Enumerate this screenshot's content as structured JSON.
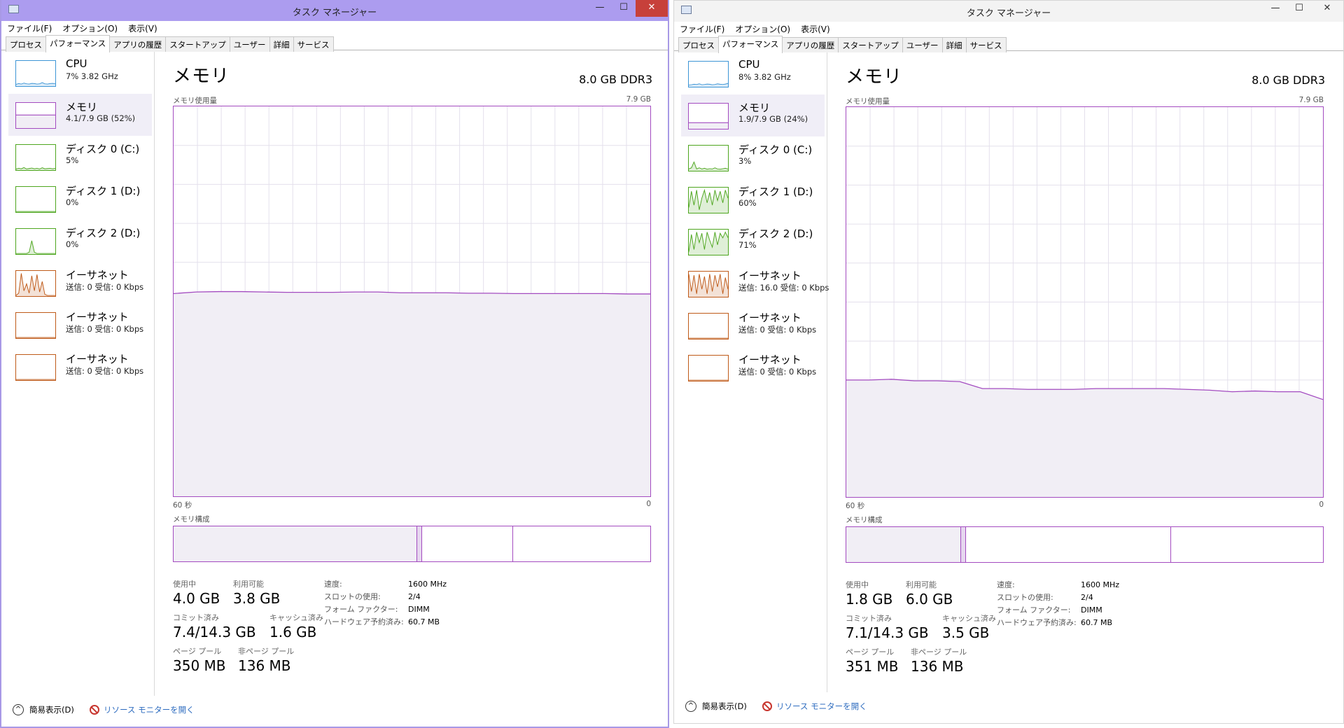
{
  "colors": {
    "memory": "#a34bc0",
    "memory_fill": "#f1eef5",
    "cpu": "#3d95d6",
    "disk": "#4ea61f",
    "net": "#bf5a19",
    "grid": "#e4e0ec"
  },
  "windows": [
    {
      "title": "タスク マネージャー",
      "controls": {
        "minimize": "—",
        "maximize": "☐",
        "close": "✕"
      },
      "menu": [
        "ファイル(F)",
        "オプション(O)",
        "表示(V)"
      ],
      "tabs": [
        "プロセス",
        "パフォーマンス",
        "アプリの履歴",
        "スタートアップ",
        "ユーザー",
        "詳細",
        "サービス"
      ],
      "active_tab": 1,
      "sidebar": [
        {
          "name": "CPU",
          "sub": "7% 3.82 GHz",
          "kind": "cpu",
          "spark": [
            0.05,
            0.08,
            0.06,
            0.1,
            0.07,
            0.06,
            0.09,
            0.08,
            0.06,
            0.07,
            0.12,
            0.07,
            0.06,
            0.08,
            0.09,
            0.07
          ]
        },
        {
          "name": "メモリ",
          "sub": "4.1/7.9 GB (52%)",
          "kind": "mem",
          "level": 0.52
        },
        {
          "name": "ディスク 0 (C:)",
          "sub": "5%",
          "kind": "disk",
          "spark": [
            0.02,
            0.05,
            0.03,
            0.08,
            0.02,
            0.04,
            0.06,
            0.03,
            0.05,
            0.02,
            0.07,
            0.03,
            0.04,
            0.05,
            0.03,
            0.05
          ]
        },
        {
          "name": "ディスク 1 (D:)",
          "sub": "0%",
          "kind": "disk",
          "spark": [
            0,
            0,
            0,
            0,
            0,
            0,
            0,
            0,
            0,
            0,
            0,
            0,
            0,
            0,
            0,
            0
          ]
        },
        {
          "name": "ディスク 2 (D:)",
          "sub": "0%",
          "kind": "disk",
          "spark": [
            0,
            0,
            0,
            0,
            0,
            0.05,
            0.55,
            0.05,
            0,
            0,
            0,
            0,
            0,
            0,
            0,
            0
          ]
        },
        {
          "name": "イーサネット",
          "sub": "送信: 0 受信: 0 Kbps",
          "kind": "net",
          "spark": [
            0,
            0.1,
            0.95,
            0.2,
            0.5,
            0.1,
            0.85,
            0.2,
            0.9,
            0.15,
            0.6,
            0.05,
            0,
            0,
            0,
            0
          ]
        },
        {
          "name": "イーサネット",
          "sub": "送信: 0 受信: 0 Kbps",
          "kind": "net",
          "spark": [
            0,
            0,
            0,
            0,
            0,
            0,
            0,
            0,
            0,
            0,
            0,
            0,
            0,
            0,
            0,
            0
          ]
        },
        {
          "name": "イーサネット",
          "sub": "送信: 0 受信: 0 Kbps",
          "kind": "net",
          "spark": [
            0,
            0,
            0,
            0,
            0,
            0,
            0,
            0,
            0,
            0,
            0,
            0,
            0,
            0,
            0,
            0
          ]
        }
      ],
      "selected": 1,
      "main": {
        "title": "メモリ",
        "spec": "8.0 GB DDR3",
        "usage_label": "メモリ使用量",
        "max_label": "7.9 GB",
        "time_left": "60 秒",
        "time_right": "0",
        "usage_series": [
          0.52,
          0.524,
          0.525,
          0.525,
          0.524,
          0.523,
          0.523,
          0.523,
          0.524,
          0.524,
          0.522,
          0.522,
          0.522,
          0.521,
          0.521,
          0.52,
          0.52,
          0.52,
          0.52,
          0.52,
          0.519,
          0.519
        ],
        "composition_label": "メモリ構成",
        "composition": {
          "in_use": 0.51,
          "modified": 0.01,
          "standby": 0.19,
          "free": 0.29
        },
        "stats": [
          {
            "label": "使用中",
            "value": "4.0 GB"
          },
          {
            "label": "利用可能",
            "value": "3.8 GB"
          },
          {
            "label": "コミット済み",
            "value": "7.4/14.3 GB"
          },
          {
            "label": "キャッシュ済み",
            "value": "1.6 GB"
          },
          {
            "label": "ページ プール",
            "value": "350 MB"
          },
          {
            "label": "非ページ プール",
            "value": "136 MB"
          }
        ],
        "details": [
          {
            "k": "速度:",
            "v": "1600 MHz"
          },
          {
            "k": "スロットの使用:",
            "v": "2/4"
          },
          {
            "k": "フォーム ファクター:",
            "v": "DIMM"
          },
          {
            "k": "ハードウェア予約済み:",
            "v": "60.7 MB"
          }
        ]
      },
      "footer": {
        "fewer": "簡易表示(D)",
        "resmon": "リソース モニターを開く"
      }
    },
    {
      "title": "タスク マネージャー",
      "controls": {
        "minimize": "—",
        "maximize": "☐",
        "close": "✕"
      },
      "menu": [
        "ファイル(F)",
        "オプション(O)",
        "表示(V)"
      ],
      "tabs": [
        "プロセス",
        "パフォーマンス",
        "アプリの履歴",
        "スタートアップ",
        "ユーザー",
        "詳細",
        "サービス"
      ],
      "active_tab": 1,
      "sidebar": [
        {
          "name": "CPU",
          "sub": "8% 3.82 GHz",
          "kind": "cpu",
          "spark": [
            0.05,
            0.06,
            0.08,
            0.07,
            0.1,
            0.06,
            0.07,
            0.09,
            0.08,
            0.06,
            0.07,
            0.1,
            0.08,
            0.07,
            0.09,
            0.12
          ]
        },
        {
          "name": "メモリ",
          "sub": "1.9/7.9 GB (24%)",
          "kind": "mem",
          "level": 0.24
        },
        {
          "name": "ディスク 0 (C:)",
          "sub": "3%",
          "kind": "disk",
          "spark": [
            0.05,
            0.1,
            0.35,
            0.05,
            0.1,
            0.05,
            0.08,
            0.04,
            0.06,
            0.05,
            0.1,
            0.05,
            0.04,
            0.06,
            0.08,
            0.05
          ]
        },
        {
          "name": "ディスク 1 (D:)",
          "sub": "60%",
          "kind": "disk",
          "spark": [
            0.2,
            0.9,
            0.3,
            0.95,
            0.1,
            0.6,
            0.95,
            0.4,
            0.85,
            0.3,
            0.95,
            0.5,
            0.9,
            0.4,
            0.95,
            0.6
          ]
        },
        {
          "name": "ディスク 2 (D:)",
          "sub": "71%",
          "kind": "disk",
          "spark": [
            0.1,
            0.85,
            0.2,
            0.95,
            0.5,
            0.9,
            0.2,
            0.95,
            0.6,
            0.3,
            0.95,
            0.4,
            0.9,
            0.7,
            0.95,
            0.71
          ]
        },
        {
          "name": "イーサネット",
          "sub": "送信: 16.0 受信: 0 Kbps",
          "kind": "net",
          "spark": [
            0.95,
            0.2,
            0.9,
            0.1,
            0.95,
            0.3,
            0.85,
            0.1,
            0.95,
            0.2,
            0.9,
            0.4,
            0.95,
            0.1,
            0.8,
            0.3
          ]
        },
        {
          "name": "イーサネット",
          "sub": "送信: 0 受信: 0 Kbps",
          "kind": "net",
          "spark": [
            0,
            0,
            0,
            0,
            0,
            0,
            0,
            0,
            0,
            0,
            0,
            0,
            0,
            0,
            0,
            0
          ]
        },
        {
          "name": "イーサネット",
          "sub": "送信: 0 受信: 0 Kbps",
          "kind": "net",
          "spark": [
            0,
            0,
            0,
            0,
            0,
            0,
            0,
            0,
            0,
            0,
            0,
            0,
            0,
            0,
            0,
            0
          ]
        }
      ],
      "selected": 1,
      "main": {
        "title": "メモリ",
        "spec": "8.0 GB DDR3",
        "usage_label": "メモリ使用量",
        "max_label": "7.9 GB",
        "time_left": "60 秒",
        "time_right": "0",
        "usage_series": [
          0.3,
          0.3,
          0.302,
          0.298,
          0.298,
          0.296,
          0.278,
          0.278,
          0.276,
          0.276,
          0.276,
          0.278,
          0.278,
          0.278,
          0.278,
          0.276,
          0.274,
          0.27,
          0.272,
          0.27,
          0.27,
          0.25
        ],
        "composition_label": "メモリ構成",
        "composition": {
          "in_use": 0.24,
          "modified": 0.01,
          "standby": 0.43,
          "free": 0.32
        },
        "stats": [
          {
            "label": "使用中",
            "value": "1.8 GB"
          },
          {
            "label": "利用可能",
            "value": "6.0 GB"
          },
          {
            "label": "コミット済み",
            "value": "7.1/14.3 GB"
          },
          {
            "label": "キャッシュ済み",
            "value": "3.5 GB"
          },
          {
            "label": "ページ プール",
            "value": "351 MB"
          },
          {
            "label": "非ページ プール",
            "value": "136 MB"
          }
        ],
        "details": [
          {
            "k": "速度:",
            "v": "1600 MHz"
          },
          {
            "k": "スロットの使用:",
            "v": "2/4"
          },
          {
            "k": "フォーム ファクター:",
            "v": "DIMM"
          },
          {
            "k": "ハードウェア予約済み:",
            "v": "60.7 MB"
          }
        ]
      },
      "footer": {
        "fewer": "簡易表示(D)",
        "resmon": "リソース モニターを開く"
      }
    }
  ]
}
